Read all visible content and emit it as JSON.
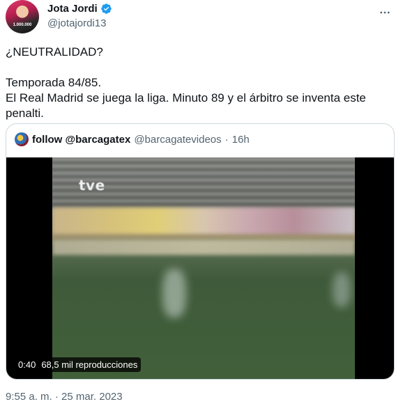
{
  "author": {
    "display_name": "Jota Jordi",
    "handle": "@jotajordi13",
    "avatar_caption": "1.000.000",
    "verified_color": "#1d9bf0"
  },
  "tweet": {
    "paragraphs": [
      "¿NEUTRALIDAD?",
      "Temporada 84/85.",
      "El Real Madrid se juega la liga. Minuto 89 y el árbitro se inventa este penalti."
    ],
    "timestamp": "9:55 a. m. · 25 mar. 2023"
  },
  "quoted": {
    "display_name": "follow @barcagatex",
    "handle": "@barcagatevideos",
    "separator": "·",
    "time_ago": "16h",
    "video": {
      "broadcaster_logo": "tve",
      "duration": "0:40",
      "views": "68,5 mil reproducciones"
    }
  },
  "icons": {
    "more": "more-horizontal-icon",
    "verified": "verified-badge-icon"
  }
}
